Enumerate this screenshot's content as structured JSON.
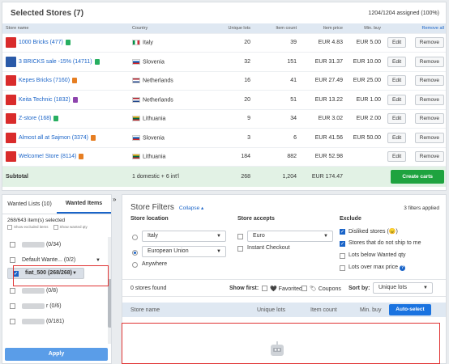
{
  "selected": {
    "title": "Selected Stores (7)",
    "assigned": "1204/1204 assigned (100%)",
    "columns": [
      "Store name",
      "Country",
      "Unique lots",
      "Item count",
      "Item price",
      "Min. buy"
    ],
    "remove_all": "Remove all",
    "edit_label": "Edit",
    "remove_label": "Remove",
    "rows": [
      {
        "name": "1000 Bricks (477)",
        "icon_color": "#d92b2b",
        "lock_color": "#27ae60",
        "country": "Italy",
        "flag": "italy",
        "lots": "20",
        "items": "39",
        "price": "EUR 4.83",
        "min": "EUR 5.00"
      },
      {
        "name": "3 BRICKS sale -15% (14711)",
        "icon_color": "#2a5aa8",
        "lock_color": "#27ae60",
        "country": "Slovenia",
        "flag": "slovenia",
        "lots": "32",
        "items": "151",
        "price": "EUR 31.37",
        "min": "EUR 10.00"
      },
      {
        "name": "Kepes Bricks (7160)",
        "icon_color": "#d92b2b",
        "lock_color": "#e67e22",
        "country": "Netherlands",
        "flag": "netherlands",
        "lots": "16",
        "items": "41",
        "price": "EUR 27.49",
        "min": "EUR 25.00"
      },
      {
        "name": "Keita Technic (1832)",
        "icon_color": "#d92b2b",
        "lock_color": "#8e44ad",
        "country": "Netherlands",
        "flag": "netherlands",
        "lots": "20",
        "items": "51",
        "price": "EUR 13.22",
        "min": "EUR 1.00"
      },
      {
        "name": "Z-store (168)",
        "icon_color": "#d92b2b",
        "lock_color": "#27ae60",
        "country": "Lithuania",
        "flag": "lithuania",
        "lots": "9",
        "items": "34",
        "price": "EUR 3.02",
        "min": "EUR 2.00"
      },
      {
        "name": "Almost all at Sajmon (3374)",
        "icon_color": "#d92b2b",
        "lock_color": "#e67e22",
        "country": "Slovenia",
        "flag": "slovenia",
        "lots": "3",
        "items": "6",
        "price": "EUR 41.56",
        "min": "EUR 50.00"
      },
      {
        "name": "Welcome! Store (8114)",
        "icon_color": "#d92b2b",
        "lock_color": "#e67e22",
        "country": "Lithuania",
        "flag": "lithuania",
        "lots": "184",
        "items": "882",
        "price": "EUR 52.98",
        "min": ""
      }
    ],
    "subtotal": {
      "label": "Subtotal",
      "country": "1 domestic + 6 int'l",
      "lots": "268",
      "items": "1,204",
      "price": "EUR 174.47",
      "button": "Create carts"
    }
  },
  "wanted": {
    "tabs": [
      "Wanted Lists (10)",
      "Wanted Items"
    ],
    "collapse_glyph": "»",
    "selected_count": "268/643 item(s) selected",
    "opt_excluded": "Show excluded items",
    "opt_wanted_qty": "Show wanted qty",
    "items": [
      {
        "label": "(0/34)",
        "blurred": true,
        "checked": false,
        "selected": false
      },
      {
        "label": "Default Wante... (0/2)",
        "blurred": false,
        "checked": false,
        "selected": false
      },
      {
        "label": "fiat_500 (268/268)",
        "blurred": false,
        "checked": true,
        "selected": true
      },
      {
        "label": "(0/108)",
        "blurred": true,
        "checked": false,
        "selected": false
      },
      {
        "label": "(0/8)",
        "blurred": true,
        "checked": false,
        "selected": false
      },
      {
        "label": "r (0/6)",
        "blurred": true,
        "checked": false,
        "selected": false
      },
      {
        "label": "(0/181)",
        "blurred": true,
        "checked": false,
        "selected": false
      }
    ],
    "apply": "Apply"
  },
  "filters": {
    "title": "Store Filters",
    "collapse": "Collapse ▴",
    "applied": "3 filters applied",
    "location_label": "Store location",
    "country_value": "Italy",
    "region_value": "European Union",
    "anywhere": "Anywhere",
    "accepts_label": "Store accepts",
    "currency_value": "Euro",
    "instant_checkout": "Instant Checkout",
    "exclude_label": "Exclude",
    "exclude_options": [
      {
        "label": "Disliked stores (😠)",
        "checked": true
      },
      {
        "label": "Stores that do not ship to me",
        "checked": true
      },
      {
        "label": "Lots below Wanted qty",
        "checked": false
      },
      {
        "label": "Lots over max price",
        "checked": false
      }
    ],
    "found": "0 stores found",
    "show_first": "Show first:",
    "favorited": "Favorited",
    "coupons": "Coupons",
    "sort_by": "Sort by:",
    "sort_value": "Unique lots",
    "result_columns": [
      "Store name",
      "Unique lots",
      "Item count",
      "Min. buy"
    ],
    "auto_select": "Auto-select"
  }
}
